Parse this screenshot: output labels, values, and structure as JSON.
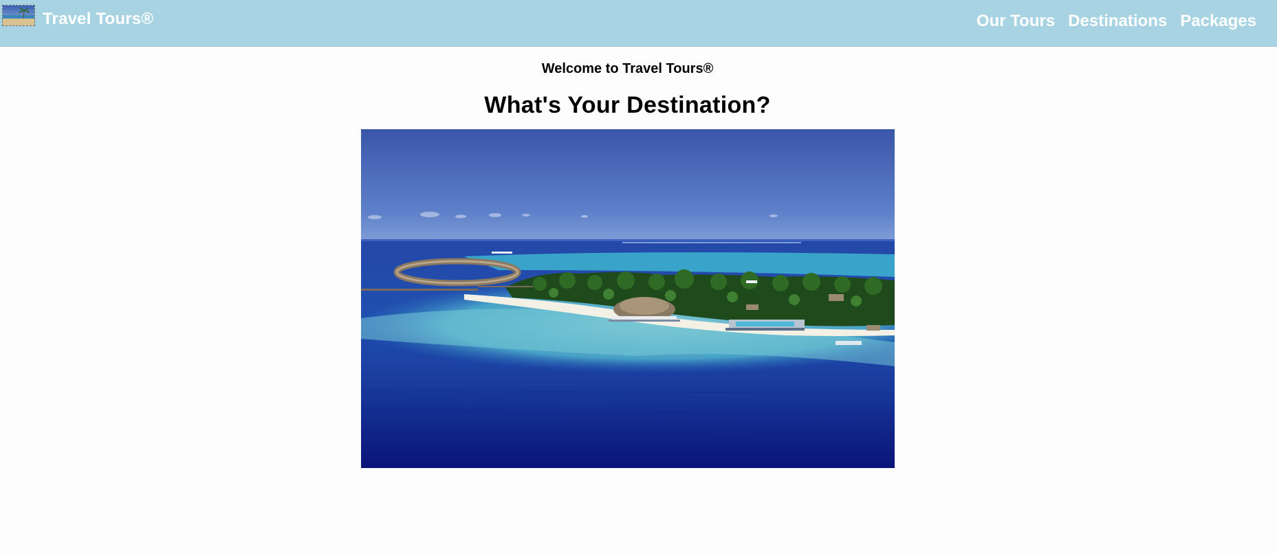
{
  "header": {
    "brand": "Travel Tours®",
    "logo_icon": "beach-photo-thumbnail",
    "nav": [
      {
        "label": "Our Tours"
      },
      {
        "label": "Destinations"
      },
      {
        "label": "Packages"
      }
    ],
    "background_color": "#a7d3e3",
    "text_color": "#ffffff"
  },
  "main": {
    "welcome": "Welcome to Travel Tours®",
    "headline": "What's Your Destination?",
    "hero_image": "tropical-island-resort-photo"
  }
}
